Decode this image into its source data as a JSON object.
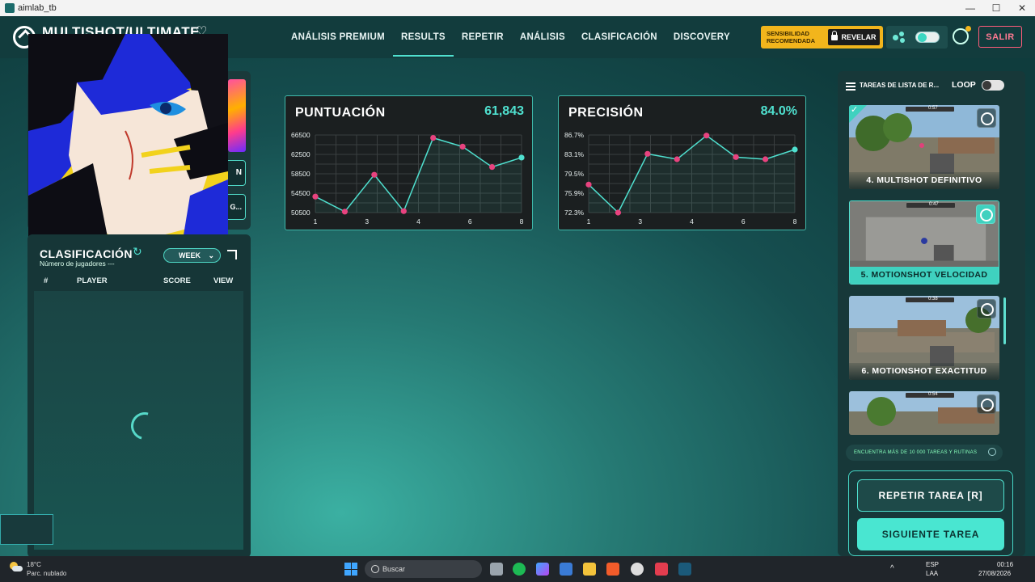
{
  "window": {
    "title": "aimlab_tb",
    "controls": [
      "—",
      "☐",
      "✕"
    ]
  },
  "header": {
    "task_title": "MULTISHOT/ULTIMATE",
    "heart_symbol": "♡",
    "tabs": [
      {
        "label": "ANÁLISIS PREMIUM",
        "active": false
      },
      {
        "label": "RESULTS",
        "active": true
      },
      {
        "label": "REPETIR",
        "active": false
      },
      {
        "label": "ANÁLISIS",
        "active": false
      },
      {
        "label": "CLASIFICACIÓN",
        "active": false
      },
      {
        "label": "DISCOVERY",
        "active": false
      }
    ],
    "sensitivity_line1": "SENSIBILIDAD",
    "sensitivity_line2": "RECOMENDADA",
    "reveal_label": "REVELAR",
    "exit_label": "SALIR"
  },
  "left": {
    "btn1_text": "N",
    "btn2_text": "G..."
  },
  "leaderboard": {
    "title": "CLASIFICACIÓN",
    "subtitle": "Número de jugadores ---",
    "period": "WEEK",
    "columns": {
      "rank": "#",
      "player": "PLAYER",
      "score": "SCORE",
      "view": "VIEW"
    }
  },
  "chart_data": [
    {
      "type": "line",
      "title": "PUNTUACIÓN",
      "headline_value": "61,843",
      "x": [
        1,
        2,
        3,
        4,
        5,
        6,
        7,
        8
      ],
      "x_tick_labels": [
        "1",
        "3",
        "4",
        "6",
        "8"
      ],
      "values": [
        53800,
        50700,
        58300,
        50800,
        65900,
        64100,
        59900,
        61843
      ],
      "y_tick_labels": [
        "66500",
        "62500",
        "58500",
        "54500",
        "50500"
      ],
      "ylim": [
        50500,
        66500
      ],
      "grid": true,
      "colors": {
        "line": "#4fe0cf",
        "point": "#e8437f",
        "last_point": "#4fe0cf"
      }
    },
    {
      "type": "line",
      "title": "PRECISIÓN",
      "headline_value": "84.0%",
      "x": [
        1,
        2,
        3,
        4,
        5,
        6,
        7,
        8
      ],
      "x_tick_labels": [
        "1",
        "3",
        "4",
        "6",
        "8"
      ],
      "values": [
        77.5,
        72.3,
        83.2,
        82.2,
        86.6,
        82.6,
        82.2,
        84.0
      ],
      "y_tick_labels": [
        "86.7%",
        "83.1%",
        "79.5%",
        "75.9%",
        "72.3%"
      ],
      "ylim": [
        72.3,
        86.7
      ],
      "grid": true,
      "colors": {
        "line": "#4fe0cf",
        "point": "#e8437f",
        "last_point": "#4fe0cf"
      }
    }
  ],
  "right": {
    "list_title": "TAREAS DE LISTA DE R...",
    "loop_label": "LOOP",
    "tasks": [
      {
        "label": "4. MULTISHOT DEFINITIVO",
        "time": "0:57",
        "completed": true,
        "active": false
      },
      {
        "label": "5. MOTIONSHOT VELOCIDAD",
        "time": "0:47",
        "completed": false,
        "active": true
      },
      {
        "label": "6. MOTIONSHOT EXACTITUD",
        "time": "0:38",
        "completed": false,
        "active": false
      },
      {
        "label": "",
        "time": "0:54",
        "completed": false,
        "active": false
      }
    ],
    "search_placeholder": "ENCUENTRA MÁS DE 10 000 TAREAS Y RUTINAS",
    "repeat_label": "REPETIR TAREA [R]",
    "next_label": "SIGUIENTE TAREA"
  },
  "taskbar": {
    "temperature": "18°C",
    "condition": "Parc. nublado",
    "search_label": "Buscar",
    "lang1": "ESP",
    "lang2": "LAA",
    "time": "00:16",
    "date": "27/08/2026"
  },
  "colors": {
    "accent": "#4fe0cf",
    "point": "#e8437f",
    "warning": "#f2b51c",
    "danger": "#ff5c7a"
  }
}
